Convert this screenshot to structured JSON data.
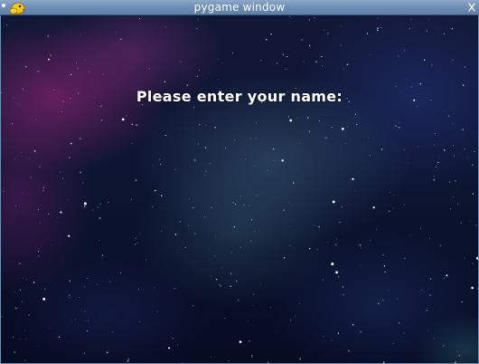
{
  "window": {
    "title": "pygame window",
    "app_icon": "pygame-snake-icon",
    "close_icon": "close-icon",
    "menu_icon": "window-menu-icon"
  },
  "game": {
    "prompt": "Please enter your name:",
    "background": "starfield-nebula",
    "colors": {
      "prompt_text": "#ffffff",
      "titlebar": "#6f8fb5"
    }
  }
}
